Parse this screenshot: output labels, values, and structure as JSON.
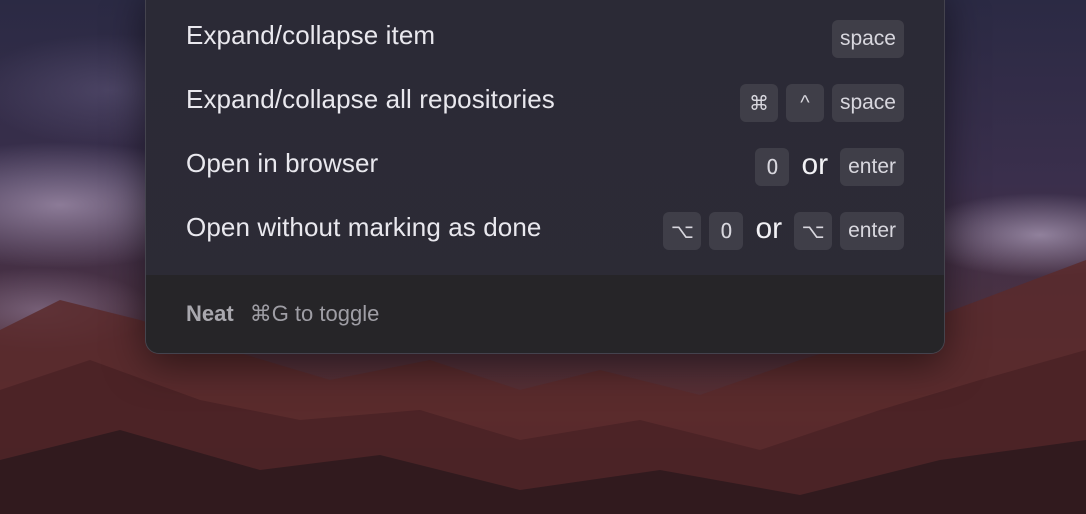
{
  "shortcuts": [
    {
      "label": "Expand/collapse item",
      "keys": [
        "space"
      ]
    },
    {
      "label": "Expand/collapse all repositories",
      "keys": [
        "⌘",
        "^",
        "space"
      ]
    },
    {
      "label": "Open in browser",
      "keys": [
        "O"
      ],
      "or": "or",
      "alt_keys": [
        "enter"
      ]
    },
    {
      "label": "Open without marking as done",
      "keys": [
        "⌥",
        "O"
      ],
      "or": "or",
      "alt_keys": [
        "⌥",
        "enter"
      ]
    }
  ],
  "footer": {
    "app_name": "Neat",
    "hint": "⌘G to toggle"
  }
}
